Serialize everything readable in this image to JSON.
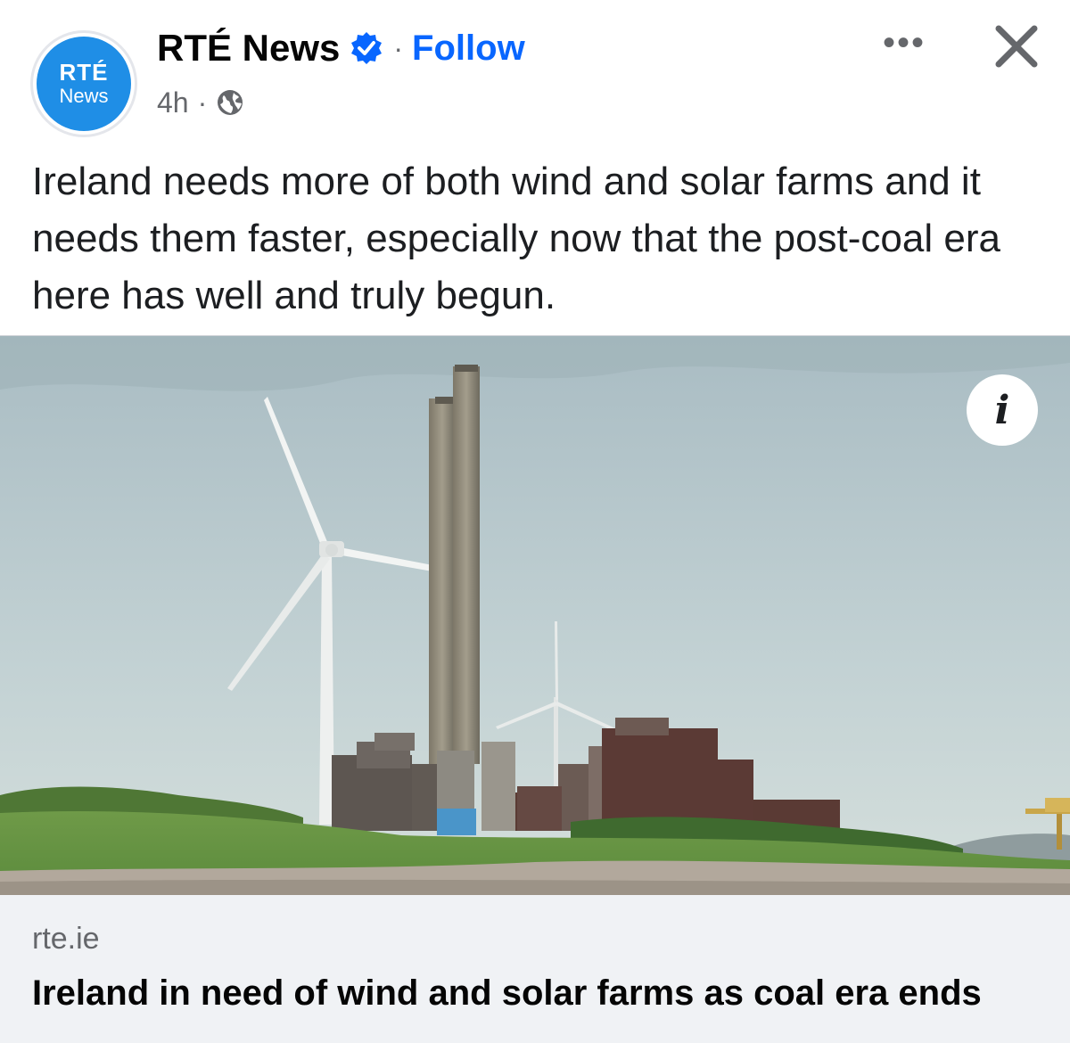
{
  "header": {
    "avatar_line1": "RTÉ",
    "avatar_line2": "News",
    "page_name": "RTÉ News",
    "separator": "·",
    "follow_label": "Follow",
    "timestamp": "4h",
    "meta_separator": "·",
    "audience_icon": "globe-icon",
    "more_label": "•••",
    "close_icon": "close-icon",
    "verified_icon": "verified-badge-icon"
  },
  "post": {
    "caption": "Ireland needs more of both wind and solar farms and it needs them faster, especially now that the post-coal era here has well and truly begun."
  },
  "image": {
    "info_label": "i"
  },
  "link_preview": {
    "domain": "rte.ie",
    "title": "Ireland in need of wind and solar farms as coal era ends"
  },
  "colors": {
    "accent": "#0866ff",
    "avatar_blue": "#1f8ee6",
    "secondary_text": "#65676b",
    "link_box_bg": "#f0f2f5"
  }
}
